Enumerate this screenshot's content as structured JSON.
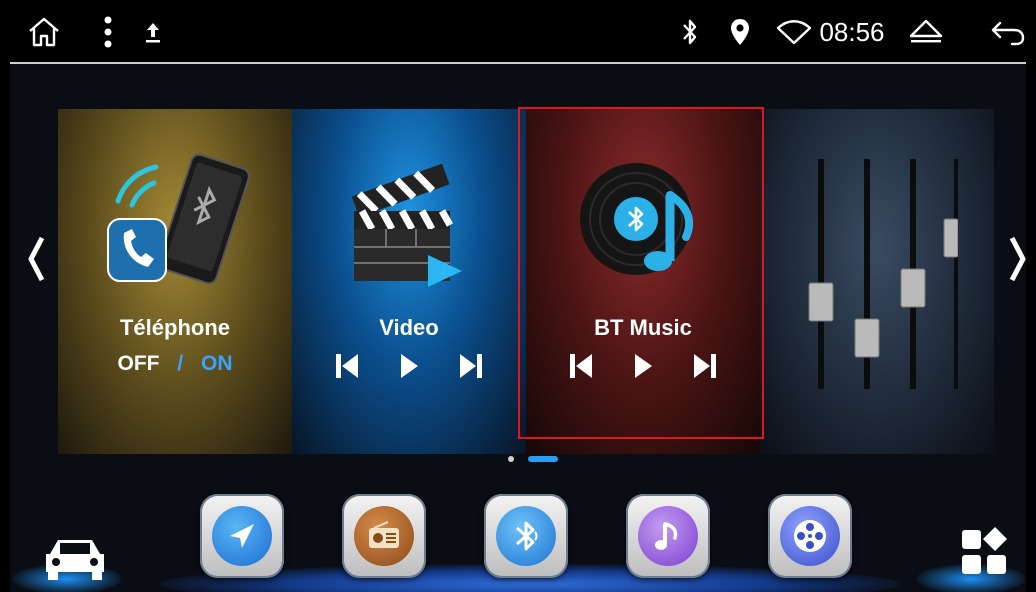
{
  "status_bar": {
    "time": "08:56",
    "icons": [
      "home-icon",
      "menu-dots-icon",
      "upload-icon",
      "bluetooth-icon",
      "location-icon",
      "wifi-icon",
      "eject-icon",
      "back-icon"
    ]
  },
  "tiles": [
    {
      "label": "Téléphone",
      "off": "OFF",
      "sep": "/",
      "on": "ON",
      "icon": "phone-bluetooth-icon"
    },
    {
      "label": "Video",
      "icon": "clapperboard-icon"
    },
    {
      "label": "BT Music",
      "icon": "bt-music-disc-icon"
    },
    {
      "label": "",
      "icon": "equalizer-sliders-icon"
    }
  ],
  "pagination": {
    "pages": 2,
    "current": 2
  },
  "dock": [
    "car-icon",
    "navigation-icon",
    "radio-icon",
    "bluetooth-icon",
    "music-icon",
    "film-reel-icon",
    "apps-grid-icon"
  ],
  "colors": {
    "accent": "#2a9df4",
    "highlight": "#e3151a",
    "on": "#3aa2ff"
  }
}
